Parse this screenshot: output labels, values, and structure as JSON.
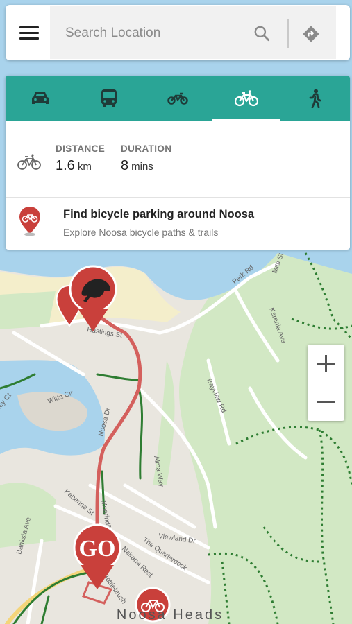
{
  "search": {
    "placeholder": "Search Location"
  },
  "icons": {
    "menu": "menu-icon",
    "search": "search-icon",
    "directions": "directions-icon"
  },
  "modes": [
    {
      "name": "car",
      "icon": "car-icon",
      "active": false
    },
    {
      "name": "bus",
      "icon": "bus-icon",
      "active": false
    },
    {
      "name": "motorcycle",
      "icon": "motorcycle-icon",
      "active": false
    },
    {
      "name": "bicycle",
      "icon": "bicycle-icon",
      "active": true
    },
    {
      "name": "walk",
      "icon": "walk-icon",
      "active": false
    }
  ],
  "route": {
    "distance_label": "DISTANCE",
    "distance_value": "1.6",
    "distance_unit": "km",
    "duration_label": "DURATION",
    "duration_value": "8",
    "duration_unit": "mins"
  },
  "parking": {
    "title": "Find bicycle parking around Noosa",
    "subtitle": "Explore Noosa bicycle paths & trails"
  },
  "map": {
    "streets": [
      "Park Rd",
      "Mitti St",
      "Karenia Ave",
      "Witta Cir",
      "Noosa Dr",
      "Alma Way",
      "Kaharina St",
      "Moorindil St",
      "Viewland Dr",
      "The Quarterdeck",
      "Nairana Rest",
      "Bottlebrush",
      "Banksia Ave",
      "Bayview Rd",
      "Hastings St",
      "ley Ct"
    ],
    "place_label": "Noosa Heads",
    "go_marker": "GO",
    "zoom_in": "+",
    "zoom_out": "−"
  },
  "colors": {
    "accent": "#2aa596",
    "route": "#d4605d",
    "pin": "#c9403b",
    "trail": "#2e7d32",
    "water": "#a9d3ec",
    "sand": "#f4eecb",
    "park": "#d2e8c4"
  }
}
